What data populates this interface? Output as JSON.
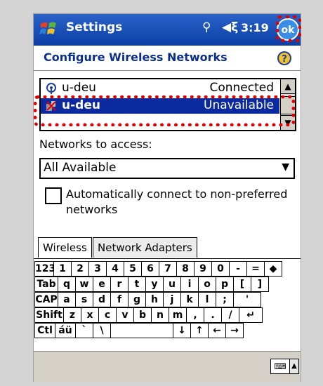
{
  "titlebar": {
    "title": "Settings",
    "clock": "3:19",
    "ok_label": "ok",
    "signal_icon": "signal-icon",
    "volume_icon": "volume-icon",
    "windows_icon": "windows-start-icon"
  },
  "page": {
    "header": "Configure Wireless Networks",
    "help_icon": "help-icon"
  },
  "networks": [
    {
      "name": "u-deu",
      "status": "Connected",
      "icon": "wifi-icon"
    },
    {
      "name": "u-deu",
      "status": "Unavailable",
      "icon": "ad-hoc-network-icon"
    },
    {
      "name": "",
      "status": "",
      "icon": ""
    }
  ],
  "access": {
    "label": "Networks to access:",
    "selected": "All Available"
  },
  "auto_connect": {
    "label": "Automatically connect to non-preferred networks",
    "checked": false
  },
  "tabs": [
    {
      "label": "Wireless"
    },
    {
      "label": "Network Adapters"
    }
  ],
  "keyboard": {
    "rows": [
      [
        "123",
        "1",
        "2",
        "3",
        "4",
        "5",
        "6",
        "7",
        "8",
        "9",
        "0",
        "-",
        "=",
        "◆"
      ],
      [
        "Tab",
        "q",
        "w",
        "e",
        "r",
        "t",
        "y",
        "u",
        "i",
        "o",
        "p",
        "[",
        "]"
      ],
      [
        "CAP",
        "a",
        "s",
        "d",
        "f",
        "g",
        "h",
        "j",
        "k",
        "l",
        ";",
        "'"
      ],
      [
        "Shift",
        "z",
        "x",
        "c",
        "v",
        "b",
        "n",
        "m",
        ",",
        ".",
        "/",
        "↵"
      ],
      [
        "Ctl",
        "áü",
        "`",
        "\\",
        "",
        "",
        "",
        "↓",
        "↑",
        "←",
        "→"
      ]
    ]
  },
  "colors": {
    "titlebar": "#0b3fa5",
    "selection": "#0b2aa0",
    "highlight": "#e00000"
  }
}
